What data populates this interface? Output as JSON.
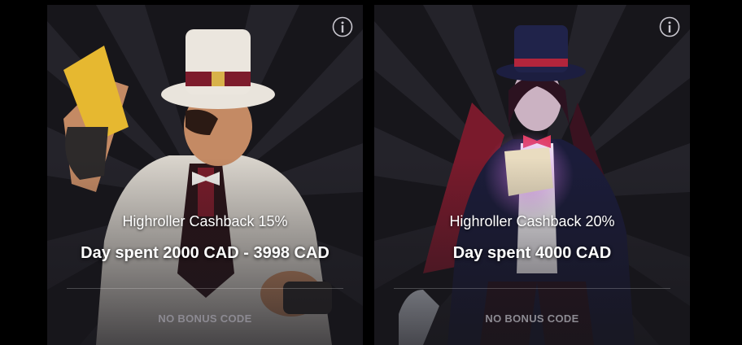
{
  "cards": [
    {
      "title": "Highroller Cashback 15%",
      "amount": "Day spent 2000 CAD - 3998 CAD",
      "code_label": "NO BONUS CODE",
      "info_icon": "info-icon",
      "image": "gentleman-with-ticket"
    },
    {
      "title": "Highroller Cashback 20%",
      "amount": "Day spent 4000 CAD",
      "code_label": "NO BONUS CODE",
      "info_icon": "info-icon",
      "image": "magician-woman-with-cards"
    }
  ],
  "colors": {
    "background": "#000000",
    "card_background": "#17161b",
    "ray": "#24232a",
    "text": "#ffffff",
    "code_text": "#8c8a92"
  }
}
